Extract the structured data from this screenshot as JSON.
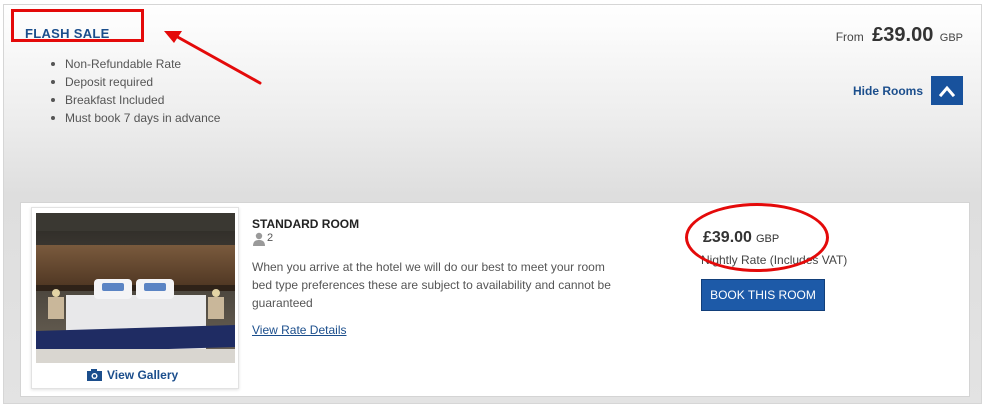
{
  "rate": {
    "title": "FLASH SALE",
    "features": [
      "Non-Refundable Rate",
      "Deposit required",
      "Breakfast Included",
      "Must book 7 days in advance"
    ],
    "from_label": "From",
    "from_price": "£39.00",
    "from_currency": "GBP",
    "hide_rooms_label": "Hide Rooms"
  },
  "room": {
    "name": "STANDARD ROOM",
    "occupancy": "2",
    "description": "When you arrive at the hotel we will do our best to meet your room bed type preferences these are subject to availability and cannot be guaranteed",
    "view_rate_details": "View Rate Details",
    "view_gallery": "View Gallery",
    "price": "£39.00",
    "currency": "GBP",
    "nightly_rate_label": "Nightly Rate (Includes VAT)",
    "book_button": "BOOK THIS ROOM"
  },
  "icons": {
    "chevron": "chevron-up-icon",
    "camera": "camera-icon",
    "person": "person-icon"
  },
  "colors": {
    "brand_blue": "#1b4e8c",
    "button_blue": "#1d5aa8",
    "annotation_red": "#e40a0a"
  }
}
